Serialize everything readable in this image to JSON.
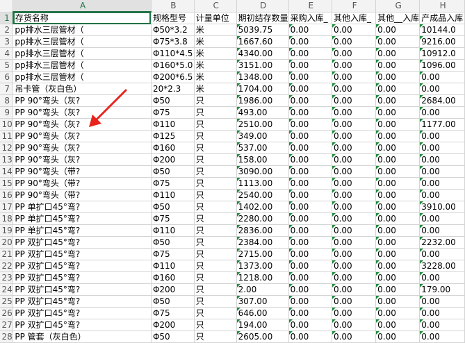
{
  "columns": [
    "A",
    "B",
    "C",
    "D",
    "E",
    "F",
    "G",
    "H"
  ],
  "selected_column": "A",
  "selected_row": "1",
  "header_row": {
    "row_num": "1",
    "cells": [
      "存货名称",
      "规格型号",
      "计量单位",
      "期初结存数量",
      "采购入库_",
      "其他入库_",
      "其他__入库",
      "产成品入库"
    ]
  },
  "rows": [
    {
      "n": "2",
      "a": "pp排水三层管材（",
      "b": "Φ50*3.2",
      "c": "米",
      "d": "5039.75",
      "e": "0.00",
      "f": "0.00",
      "g": "0.00",
      "h": "10144.0"
    },
    {
      "n": "3",
      "a": "pp排水三层管材（",
      "b": "Φ75*3.8",
      "c": "米",
      "d": "1667.60",
      "e": "0.00",
      "f": "0.00",
      "g": "0.00",
      "h": "9216.00"
    },
    {
      "n": "4",
      "a": "pp排水三层管材（",
      "b": "Φ110*4.5",
      "c": "米",
      "d": "4340.00",
      "e": "0.00",
      "f": "0.00",
      "g": "0.00",
      "h": "10912.0"
    },
    {
      "n": "5",
      "a": "pp排水三层管材（",
      "b": "Φ160*5.0",
      "c": "米",
      "d": "3151.00",
      "e": "0.00",
      "f": "0.00",
      "g": "0.00",
      "h": "1096.00"
    },
    {
      "n": "6",
      "a": "pp排水三层管材（",
      "b": "Φ200*6.5",
      "c": "米",
      "d": "1348.00",
      "e": "0.00",
      "f": "0.00",
      "g": "0.00",
      "h": "0.00"
    },
    {
      "n": "7",
      "a": "吊卡管（灰白色）",
      "b": "20*2.3",
      "c": "米",
      "d": "1704.00",
      "e": "0.00",
      "f": "0.00",
      "g": "0.00",
      "h": "0.00"
    },
    {
      "n": "8",
      "a": "PP 90°弯头（灰?",
      "b": "Φ50",
      "c": "只",
      "d": "1986.00",
      "e": "0.00",
      "f": "0.00",
      "g": "0.00",
      "h": "2684.00"
    },
    {
      "n": "9",
      "a": "PP 90°弯头（灰?",
      "b": "Φ75",
      "c": "只",
      "d": "493.00",
      "e": "0.00",
      "f": "0.00",
      "g": "0.00",
      "h": "0.00"
    },
    {
      "n": "10",
      "a": "PP 90°弯头（灰?",
      "b": "Φ110",
      "c": "只",
      "d": "2510.00",
      "e": "0.00",
      "f": "0.00",
      "g": "0.00",
      "h": "1177.00"
    },
    {
      "n": "11",
      "a": "PP 90°弯头（灰?",
      "b": "Φ125",
      "c": "只",
      "d": "349.00",
      "e": "0.00",
      "f": "0.00",
      "g": "0.00",
      "h": "0.00"
    },
    {
      "n": "12",
      "a": "PP 90°弯头（灰?",
      "b": "Φ160",
      "c": "只",
      "d": "537.00",
      "e": "0.00",
      "f": "0.00",
      "g": "0.00",
      "h": "0.00"
    },
    {
      "n": "13",
      "a": "PP 90°弯头（灰?",
      "b": "Φ200",
      "c": "只",
      "d": "158.00",
      "e": "0.00",
      "f": "0.00",
      "g": "0.00",
      "h": "0.00"
    },
    {
      "n": "14",
      "a": "PP 90°弯头（带?",
      "b": "Φ50",
      "c": "只",
      "d": "3090.00",
      "e": "0.00",
      "f": "0.00",
      "g": "0.00",
      "h": "0.00"
    },
    {
      "n": "15",
      "a": "PP 90°弯头（带?",
      "b": "Φ75",
      "c": "只",
      "d": "1113.00",
      "e": "0.00",
      "f": "0.00",
      "g": "0.00",
      "h": "0.00"
    },
    {
      "n": "16",
      "a": "PP 90°弯头（带?",
      "b": "Φ110",
      "c": "只",
      "d": "2540.00",
      "e": "0.00",
      "f": "0.00",
      "g": "0.00",
      "h": "0.00"
    },
    {
      "n": "17",
      "a": "PP 单扩口45°弯?",
      "b": "Φ50",
      "c": "只",
      "d": "1402.00",
      "e": "0.00",
      "f": "0.00",
      "g": "0.00",
      "h": "3910.00"
    },
    {
      "n": "18",
      "a": "PP 单扩口45°弯?",
      "b": "Φ75",
      "c": "只",
      "d": "2280.00",
      "e": "0.00",
      "f": "0.00",
      "g": "0.00",
      "h": "0.00"
    },
    {
      "n": "19",
      "a": "PP 单扩口45°弯?",
      "b": "Φ110",
      "c": "只",
      "d": "2836.00",
      "e": "0.00",
      "f": "0.00",
      "g": "0.00",
      "h": "0.00"
    },
    {
      "n": "20",
      "a": "PP 双扩口45°弯?",
      "b": "Φ50",
      "c": "只",
      "d": "2384.00",
      "e": "0.00",
      "f": "0.00",
      "g": "0.00",
      "h": "2232.00"
    },
    {
      "n": "21",
      "a": "PP 双扩口45°弯?",
      "b": "Φ75",
      "c": "只",
      "d": "2715.00",
      "e": "0.00",
      "f": "0.00",
      "g": "0.00",
      "h": "0.00"
    },
    {
      "n": "22",
      "a": "PP 双扩口45°弯?",
      "b": "Φ110",
      "c": "只",
      "d": "1373.00",
      "e": "0.00",
      "f": "0.00",
      "g": "0.00",
      "h": "3228.00"
    },
    {
      "n": "23",
      "a": "PP 双扩口45°弯?",
      "b": "Φ160",
      "c": "只",
      "d": "1218.00",
      "e": "0.00",
      "f": "0.00",
      "g": "0.00",
      "h": "0.00"
    },
    {
      "n": "24",
      "a": "PP 双扩口45°弯?",
      "b": "Φ200",
      "c": "只",
      "d": "2.00",
      "e": "0.00",
      "f": "0.00",
      "g": "0.00",
      "h": "179.00"
    },
    {
      "n": "25",
      "a": "PP 双扩口45°弯?",
      "b": "Φ50",
      "c": "只",
      "d": "307.00",
      "e": "0.00",
      "f": "0.00",
      "g": "0.00",
      "h": "0.00"
    },
    {
      "n": "26",
      "a": "PP 双扩口45°弯?",
      "b": "Φ75",
      "c": "只",
      "d": "646.00",
      "e": "0.00",
      "f": "0.00",
      "g": "0.00",
      "h": "0.00"
    },
    {
      "n": "27",
      "a": "PP 双扩口45°弯?",
      "b": "Φ200",
      "c": "只",
      "d": "194.00",
      "e": "0.00",
      "f": "0.00",
      "g": "0.00",
      "h": "0.00"
    },
    {
      "n": "28",
      "a": "PP 管套（灰白色）",
      "b": "Φ50",
      "c": "只",
      "d": "2605.00",
      "e": "0.00",
      "f": "0.00",
      "g": "0.00",
      "h": "0.00"
    }
  ],
  "colors": {
    "arrow": "#e8231c",
    "selection": "#217346",
    "number_marker": "#1e8c3c"
  },
  "annotation": {
    "icon": "red-arrow-icon"
  }
}
